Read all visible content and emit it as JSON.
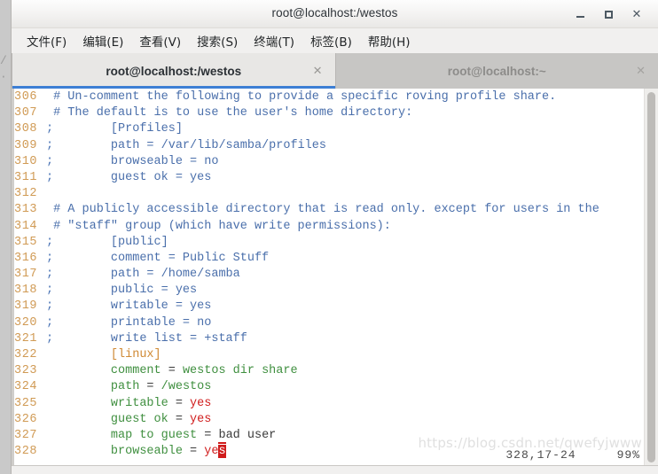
{
  "window": {
    "title": "root@localhost:/westos",
    "controls": {
      "minimize": "–",
      "maximize": "□",
      "close": "✕"
    }
  },
  "menubar": {
    "items": [
      {
        "label": "文件(F)",
        "name": "menu-file"
      },
      {
        "label": "编辑(E)",
        "name": "menu-edit"
      },
      {
        "label": "查看(V)",
        "name": "menu-view"
      },
      {
        "label": "搜索(S)",
        "name": "menu-search"
      },
      {
        "label": "终端(T)",
        "name": "menu-terminal"
      },
      {
        "label": "标签(B)",
        "name": "menu-tabs"
      },
      {
        "label": "帮助(H)",
        "name": "menu-help"
      }
    ]
  },
  "tabs": [
    {
      "label": "root@localhost:/westos",
      "active": true,
      "close": "✕"
    },
    {
      "label": "root@localhost:~",
      "active": false,
      "close": "✕"
    }
  ],
  "editor": {
    "file_type": "smb.conf",
    "lines": [
      {
        "num": "306",
        "marker": "",
        "text": "# Un-comment the following to provide a specific roving profile share.",
        "style": "cmt"
      },
      {
        "num": "307",
        "marker": "",
        "text": "# The default is to use the user's home directory:",
        "style": "cmt"
      },
      {
        "num": "308",
        "marker": ";",
        "text": "        [Profiles]",
        "style": "cmt"
      },
      {
        "num": "309",
        "marker": ";",
        "text": "        path = /var/lib/samba/profiles",
        "style": "cmt"
      },
      {
        "num": "310",
        "marker": ";",
        "text": "        browseable = no",
        "style": "cmt"
      },
      {
        "num": "311",
        "marker": ";",
        "text": "        guest ok = yes",
        "style": "cmt"
      },
      {
        "num": "312",
        "marker": "",
        "text": "",
        "style": "cmt"
      },
      {
        "num": "313",
        "marker": "",
        "text": "# A publicly accessible directory that is read only. except for users in the",
        "style": "cmt"
      },
      {
        "num": "314",
        "marker": "",
        "text": "# \"staff\" group (which have write permissions):",
        "style": "cmt"
      },
      {
        "num": "315",
        "marker": ";",
        "text": "        [public]",
        "style": "cmt"
      },
      {
        "num": "316",
        "marker": ";",
        "text": "        comment = Public Stuff",
        "style": "cmt"
      },
      {
        "num": "317",
        "marker": ";",
        "text": "        path = /home/samba",
        "style": "cmt"
      },
      {
        "num": "318",
        "marker": ";",
        "text": "        public = yes",
        "style": "cmt"
      },
      {
        "num": "319",
        "marker": ";",
        "text": "        writable = yes",
        "style": "cmt"
      },
      {
        "num": "320",
        "marker": ";",
        "text": "        printable = no",
        "style": "cmt"
      },
      {
        "num": "321",
        "marker": ";",
        "text": "        write list = +staff",
        "style": "cmt"
      }
    ],
    "active_lines": [
      {
        "num": "322",
        "section": "[linux]"
      },
      {
        "num": "323",
        "key": "comment",
        "eq": " = ",
        "value": "westos dir share",
        "value_style": "key"
      },
      {
        "num": "324",
        "key": "path",
        "eq": " = ",
        "value": "/westos",
        "value_style": "key"
      },
      {
        "num": "325",
        "key": "writable",
        "eq": " = ",
        "value": "yes",
        "value_style": "val"
      },
      {
        "num": "326",
        "key": "guest ok",
        "eq": " = ",
        "value": "yes",
        "value_style": "val"
      },
      {
        "num": "327",
        "key": "map to guest",
        "eq": " = ",
        "value": "bad user",
        "value_style": "plain-spell"
      },
      {
        "num": "328",
        "key": "browseable",
        "eq": " = ",
        "value": "yes",
        "value_style": "val-cursor"
      }
    ],
    "indent": "        "
  },
  "status": {
    "position": "328,17-24",
    "percent": "99%"
  },
  "watermark": {
    "text": "https://blog.csdn.net/qwefyjwww"
  },
  "background": {
    "edge_glyphs": "/\n·"
  },
  "colors": {
    "accent_tab_underline": "#3d7fd4",
    "line_number": "#d09a54",
    "comment": "#4a6fab",
    "section": "#d08a35",
    "key": "#3f8f3f",
    "value": "#d01c1c",
    "cursor_bg": "#d01c1c",
    "terminal_bg": "#ffffff",
    "chrome_bg": "#f1f0ef",
    "tabstrip_bg": "#c7c6c4"
  }
}
